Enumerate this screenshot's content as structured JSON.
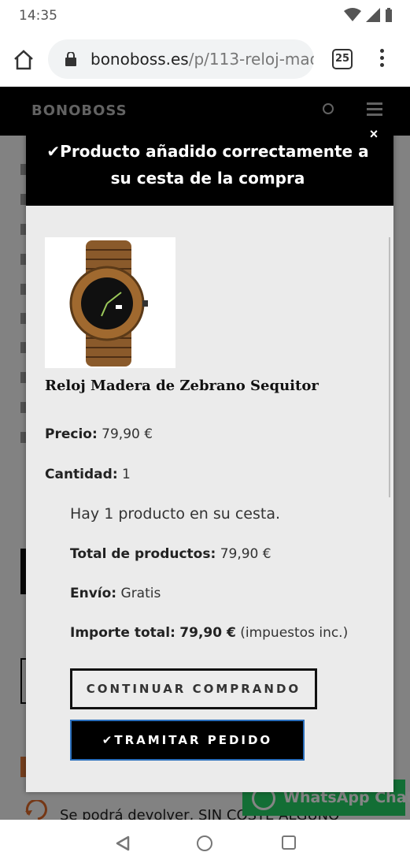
{
  "status_bar": {
    "time": "14:35"
  },
  "browser": {
    "url_host": "bonoboss.es",
    "url_path": "/p/113-reloj-mad",
    "tab_count": "25"
  },
  "site": {
    "logo_text": "BONOBOSS",
    "return_text": "Se podrá devolver, SIN COSTE ALGUNO",
    "whatsapp_label": "WhatsApp Chat"
  },
  "modal": {
    "title": "✔Producto añadido correctamente a su cesta de la compra",
    "close_symbol": "×",
    "product": {
      "name": "Reloj Madera de Zebrano Sequitor",
      "price_label": "Precio:",
      "price_value": "79,90 €",
      "quantity_label": "Cantidad:",
      "quantity_value": "1"
    },
    "cart": {
      "count_text": "Hay 1 producto en su cesta.",
      "total_products_label": "Total de productos:",
      "total_products_value": "79,90 €",
      "shipping_label": "Envío:",
      "shipping_value": "Gratis",
      "total_label": "Importe total:",
      "total_value": "79,90 €",
      "tax_note": "(impuestos inc.)"
    },
    "buttons": {
      "continue_label": "CONTINUAR COMPRANDO",
      "checkout_label": "✔TRAMITAR PEDIDO"
    }
  },
  "colors": {
    "header_black": "#000000",
    "modal_bg": "#ebebeb",
    "whatsapp_green": "#25d366",
    "checkout_border": "#2a6ebb"
  },
  "icons": [
    "home-icon",
    "lock-icon",
    "tabs-icon",
    "more-menu-icon",
    "search-icon",
    "hamburger-icon",
    "close-icon",
    "whatsapp-icon",
    "return-icon",
    "nav-back-icon",
    "nav-home-icon",
    "nav-recent-icon"
  ]
}
